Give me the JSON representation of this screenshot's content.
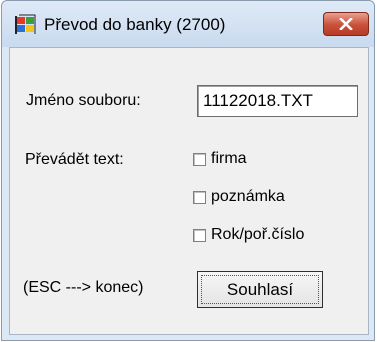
{
  "window": {
    "title": "Převod do banky (2700)",
    "close_icon": "close-x-icon",
    "app_icon": "windows-flag-icon"
  },
  "form": {
    "filename_label": "Jméno souboru:",
    "filename_value": "11122018.TXT",
    "convert_text_label": "Převádět text:",
    "checkboxes": [
      {
        "label": "firma",
        "checked": false
      },
      {
        "label": "poznámka",
        "checked": false
      },
      {
        "label": "Rok/poř.číslo",
        "checked": false
      }
    ],
    "esc_hint": "(ESC ---> konec)",
    "agree_button": "Souhlasí"
  },
  "colors": {
    "close_button": "#c8503a",
    "client_background": "#f0f0f0",
    "frame": "#dde8f5"
  }
}
